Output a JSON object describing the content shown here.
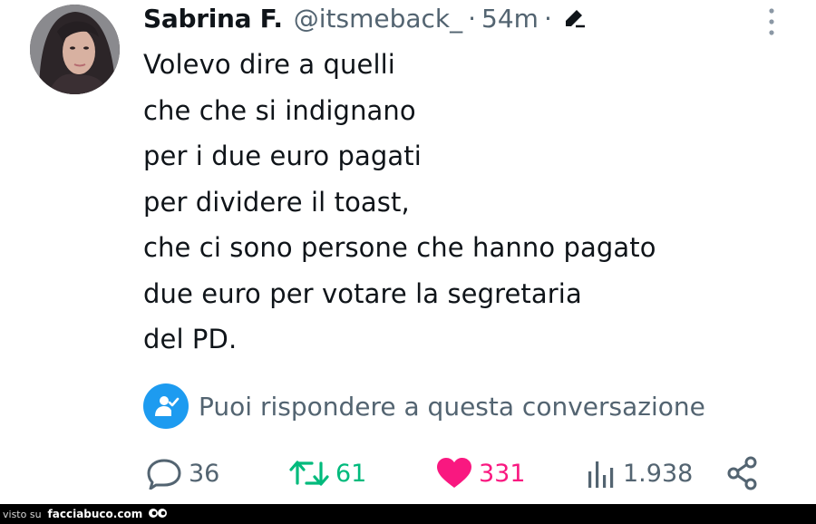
{
  "tweet": {
    "author": {
      "name": "Sabrina F.",
      "handle": "@itsmeback_",
      "separator": "·",
      "time": "54m"
    },
    "body_lines": [
      "Volevo dire a quelli",
      "che che si indignano",
      "per i due euro pagati",
      "per dividere il toast,",
      "che ci sono persone che hanno pagato",
      "due euro per votare la segretaria",
      "del PD."
    ],
    "reply_restriction": "Puoi rispondere a questa conversazione",
    "metrics": {
      "replies": "36",
      "retweets": "61",
      "likes": "331",
      "views": "1.938"
    },
    "colors": {
      "text": "#0f1419",
      "secondary": "#536471",
      "accent": "#1d9bf0",
      "retweet": "#00ba7c",
      "like": "#f91880"
    },
    "icons": [
      "edit-icon",
      "more-icon",
      "reply-permission-icon",
      "reply-icon",
      "retweet-icon",
      "like-icon",
      "views-icon",
      "share-icon"
    ]
  },
  "footer": {
    "prefix": "visto su",
    "site": "facciabuco.com"
  }
}
